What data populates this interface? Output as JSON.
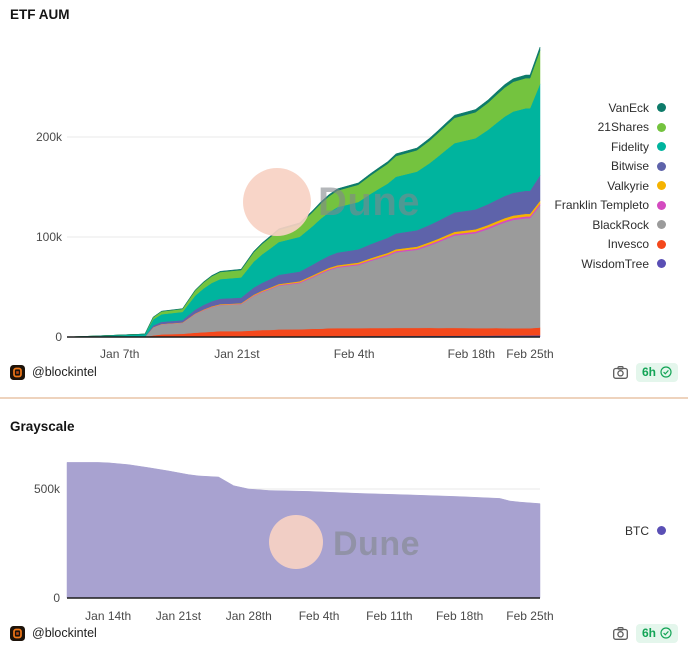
{
  "watermark": {
    "text": "Dune"
  },
  "cards": [
    {
      "title": "ETF AUM",
      "footer": {
        "handle": "@blockintel",
        "age": "6h"
      },
      "chart_data": {
        "type": "area",
        "stacked": true,
        "title": "ETF AUM",
        "legend_position": "right",
        "grid": true,
        "x_unit": "days (0 = Dec 30)",
        "x_domain": [
          1.7,
          58.2
        ],
        "y_unit": "thousands",
        "y_domain": [
          0,
          292
        ],
        "x": [
          1.7,
          5,
          11,
          12,
          13,
          15.5,
          17,
          18,
          19,
          20,
          22.5,
          24,
          25,
          26,
          27,
          29.5,
          31,
          32,
          33,
          34,
          36.5,
          38,
          39,
          40,
          41,
          43.5,
          45,
          46,
          47,
          48,
          50.5,
          52,
          53,
          54,
          55,
          56.5,
          57,
          58.2
        ],
        "x_ticks": [
          {
            "label": "Jan 7th",
            "day": 8
          },
          {
            "label": "Jan 21st",
            "day": 22
          },
          {
            "label": "Feb 4th",
            "day": 36
          },
          {
            "label": "Feb 18th",
            "day": 50
          },
          {
            "label": "Feb 25th",
            "day": 57
          }
        ],
        "y_ticks": [
          {
            "label": "0",
            "value": 0
          },
          {
            "label": "100k",
            "value": 100
          },
          {
            "label": "200k",
            "value": 200
          }
        ],
        "stack_note": "bottom-to-top stacking is the reverse of the series list",
        "series": [
          {
            "name": "VanEck",
            "color": "#0e7b6a",
            "values": [
              0,
              0,
              0,
              0.2,
              0.3,
              0.3,
              0.5,
              0.6,
              0.7,
              0.7,
              0.8,
              1.0,
              1.1,
              1.2,
              1.2,
              1.3,
              1.5,
              1.6,
              1.7,
              1.7,
              1.8,
              1.9,
              2.0,
              2.1,
              2.2,
              2.2,
              2.4,
              2.4,
              2.5,
              2.6,
              2.7,
              2.8,
              2.9,
              3.0,
              3.1,
              3.1,
              3.1,
              3.5
            ]
          },
          {
            "name": "21Shares",
            "color": "#74c33f",
            "values": [
              0,
              0,
              0,
              2.2,
              2.8,
              3.0,
              5.1,
              6.0,
              6.7,
              7.1,
              7.4,
              9.4,
              10.4,
              11.2,
              12.0,
              12.7,
              14.0,
              15.1,
              15.9,
              16.6,
              17.3,
              18.4,
              19.1,
              19.8,
              20.7,
              21.4,
              22.5,
              23.5,
              24.4,
              25.3,
              26.0,
              27.1,
              28.1,
              29.0,
              29.7,
              30.1,
              30.1,
              33.4
            ]
          },
          {
            "name": "Fidelity",
            "color": "#00b49e",
            "values": [
              0,
              1,
              3,
              6.0,
              7.6,
              8.2,
              13.9,
              16.4,
              18.3,
              19.5,
              20.2,
              25.8,
              28.4,
              30.6,
              32.8,
              34.7,
              38.4,
              41.3,
              43.5,
              45.4,
              47.3,
              50.4,
              52.3,
              54.2,
              56.7,
              58.6,
              61.7,
              64.3,
              66.8,
              69.3,
              71.2,
              74.3,
              76.9,
              79.4,
              81.3,
              82.5,
              82.5,
              91.4
            ]
          },
          {
            "name": "Bitwise",
            "color": "#5e63aa",
            "values": [
              0,
              0,
              0,
              1.7,
              2.1,
              2.3,
              3.9,
              4.6,
              5.1,
              5.5,
              5.6,
              7.2,
              7.9,
              8.5,
              9.2,
              9.7,
              10.7,
              11.5,
              12.1,
              12.7,
              13.2,
              14.1,
              14.6,
              15.1,
              15.8,
              16.4,
              17.2,
              18.0,
              18.7,
              19.4,
              19.9,
              20.8,
              21.5,
              22.2,
              22.7,
              23.1,
              23.1,
              25.5
            ]
          },
          {
            "name": "Valkyrie",
            "color": "#f5b301",
            "values": [
              0,
              0,
              0,
              0.2,
              0.2,
              0.3,
              0.4,
              0.5,
              0.6,
              0.6,
              0.6,
              0.8,
              0.9,
              1.0,
              1.0,
              1.1,
              1.2,
              1.3,
              1.4,
              1.4,
              1.5,
              1.6,
              1.7,
              1.7,
              1.8,
              1.9,
              2.0,
              2.0,
              2.1,
              2.2,
              2.3,
              2.4,
              2.4,
              2.5,
              2.6,
              2.6,
              2.6,
              2.9
            ]
          },
          {
            "name": "Franklin Templeto",
            "color": "#d44bc0",
            "values": [
              0,
              0,
              0,
              0.1,
              0.2,
              0.2,
              0.3,
              0.4,
              0.4,
              0.4,
              0.4,
              0.6,
              0.6,
              0.7,
              0.7,
              0.8,
              0.9,
              0.9,
              1.0,
              1.0,
              1.1,
              1.1,
              1.2,
              1.2,
              1.3,
              1.3,
              1.4,
              1.4,
              1.5,
              1.5,
              1.6,
              1.7,
              1.7,
              1.8,
              1.8,
              1.8,
              1.8,
              2.0
            ]
          },
          {
            "name": "BlackRock",
            "color": "#9b9b9b",
            "values": [
              0,
              0,
              0,
              8.0,
              10.1,
              10.9,
              18.5,
              21.8,
              24.4,
              26.0,
              26.9,
              34.4,
              37.8,
              40.7,
              43.7,
              46.2,
              51.2,
              55.0,
              58.0,
              60.5,
              63.0,
              67.2,
              69.7,
              72.2,
              75.6,
              78.1,
              82.3,
              85.7,
              89.0,
              92.4,
              94.9,
              99.1,
              102.5,
              105.8,
              108.4,
              110.0,
              110.0,
              121.8
            ]
          },
          {
            "name": "Invesco",
            "color": "#f4481c",
            "values": [
              0,
              0,
              0,
              1.5,
              2.5,
              3,
              4,
              4.5,
              5,
              5.5,
              5.5,
              6,
              6.5,
              6.5,
              7,
              7,
              7.5,
              7.5,
              8,
              8,
              8,
              8,
              8,
              8,
              8,
              8,
              8,
              7.8,
              7.8,
              7.8,
              7.5,
              7.5,
              7.5,
              7.3,
              7.2,
              7.2,
              7.2,
              7.8
            ]
          },
          {
            "name": "WisdomTree",
            "color": "#5a4fb5",
            "values": [
              0,
              0,
              0,
              0.1,
              0.1,
              0.2,
              0.3,
              0.3,
              0.3,
              0.4,
              0.4,
              0.5,
              0.5,
              0.6,
              0.6,
              0.7,
              0.7,
              0.8,
              0.8,
              0.9,
              0.9,
              1.0,
              1.0,
              1.0,
              1.1,
              1.1,
              1.2,
              1.2,
              1.3,
              1.3,
              1.4,
              1.4,
              1.5,
              1.5,
              1.5,
              1.6,
              1.6,
              1.7
            ]
          }
        ]
      }
    },
    {
      "title": "Grayscale",
      "footer": {
        "handle": "@blockintel",
        "age": "6h"
      },
      "chart_data": {
        "type": "area",
        "stacked": false,
        "title": "Grayscale",
        "legend_position": "right",
        "grid": true,
        "x_unit": "days (0 = Jan 10)",
        "x_domain": [
          -0.1,
          47
        ],
        "y_unit": "thousands",
        "y_domain": [
          0,
          650
        ],
        "x": [
          -0.1,
          3,
          4,
          6,
          8,
          10,
          12,
          13,
          15,
          16.5,
          18,
          20,
          24,
          29,
          34,
          39,
          43,
          44,
          45,
          47
        ],
        "x_ticks": [
          {
            "label": "Jan 14th",
            "day": 4
          },
          {
            "label": "Jan 21st",
            "day": 11
          },
          {
            "label": "Jan 28th",
            "day": 18
          },
          {
            "label": "Feb 4th",
            "day": 25
          },
          {
            "label": "Feb 11th",
            "day": 32
          },
          {
            "label": "Feb 18th",
            "day": 39
          },
          {
            "label": "Feb 25th",
            "day": 46
          }
        ],
        "y_ticks": [
          {
            "label": "0",
            "value": 0
          },
          {
            "label": "500k",
            "value": 500
          }
        ],
        "series": [
          {
            "name": "BTC",
            "color": "#a8a2d0",
            "dot_color": "#5a4fb5",
            "values": [
              622,
              622,
              620,
              612,
              598,
              583,
              566,
              560,
              555,
              515,
              500,
              493,
              489,
              480,
              473,
              465,
              457,
              445,
              440,
              433
            ]
          }
        ]
      }
    }
  ]
}
